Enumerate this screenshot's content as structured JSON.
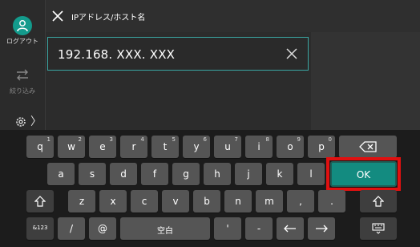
{
  "sidebar": {
    "logout_label": "ログアウト",
    "filter_label": "絞り込み"
  },
  "header": {
    "title": "IPアドレス/ホスト名"
  },
  "input": {
    "value": "192.168. XXX. XXX"
  },
  "keyboard": {
    "row1": [
      {
        "main": "q",
        "sub": "1"
      },
      {
        "main": "w",
        "sub": "2"
      },
      {
        "main": "e",
        "sub": "3"
      },
      {
        "main": "r",
        "sub": "4"
      },
      {
        "main": "t",
        "sub": "5"
      },
      {
        "main": "y",
        "sub": "6"
      },
      {
        "main": "u",
        "sub": "7"
      },
      {
        "main": "i",
        "sub": "8"
      },
      {
        "main": "o",
        "sub": "9"
      },
      {
        "main": "p",
        "sub": "0"
      }
    ],
    "row2": [
      "a",
      "s",
      "d",
      "f",
      "g",
      "h",
      "j",
      "k",
      "l"
    ],
    "row3": [
      "z",
      "x",
      "c",
      "v",
      "b",
      "n",
      "m",
      ",",
      "."
    ],
    "ok_label": "OK",
    "mode_label": "&123",
    "slash": "/",
    "at": "@",
    "space_label": "空白",
    "apostrophe": "'",
    "hyphen": "-"
  },
  "colors": {
    "accent": "#139b8c",
    "highlight": "#e01010"
  }
}
